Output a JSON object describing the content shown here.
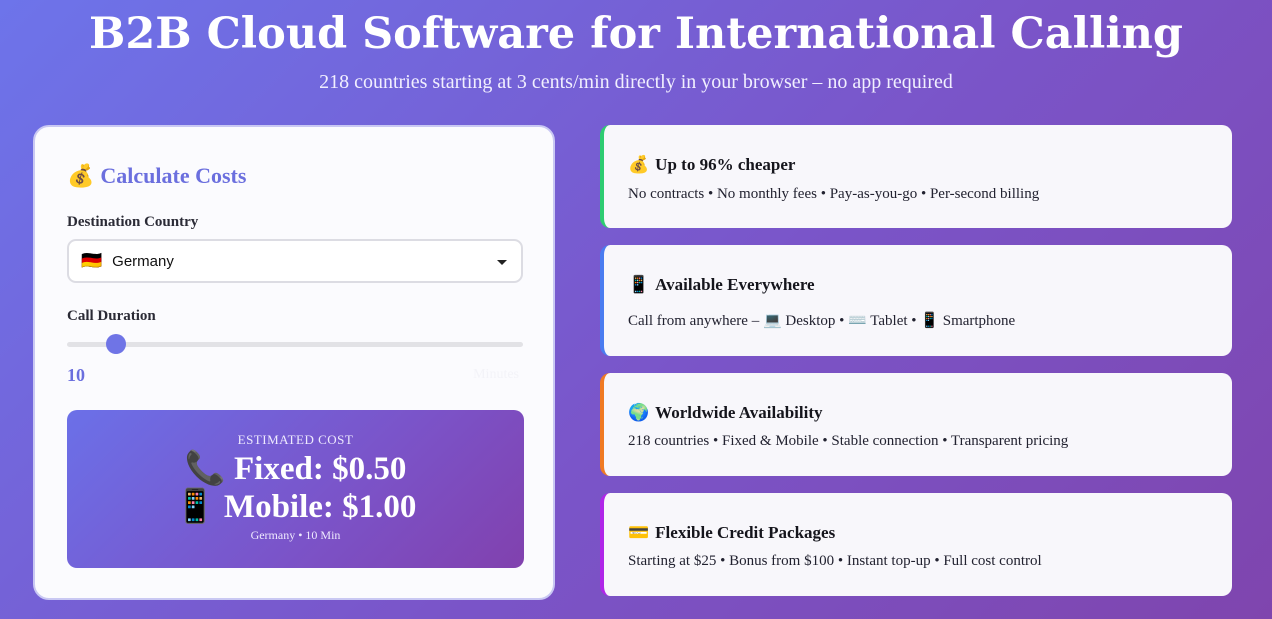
{
  "hero": {
    "title": "B2B Cloud Software for International Calling",
    "subtitle": "218 countries starting at 3 cents/min directly in your browser – no app required"
  },
  "calculator": {
    "title_icon": "💰",
    "title": "Calculate Costs",
    "destination_label": "Destination Country",
    "selected_country_flag": "🇩🇪",
    "selected_country": "Germany",
    "duration_label": "Call Duration",
    "duration_value": "10",
    "duration_unit": "Minutes",
    "duration_fraction": 0.09,
    "result": {
      "label": "ESTIMATED COST",
      "fixed": "📞 Fixed: $0.50",
      "mobile": "📱 Mobile: $1.00",
      "meta": "Germany • 10 Min"
    }
  },
  "features": [
    {
      "icon": "💰",
      "title": "Up to 96% cheaper",
      "text": "No contracts • No monthly fees • Pay-as-you-go • Per-second billing",
      "accent": "#2ecc71"
    },
    {
      "icon": "📱",
      "title": "Available Everywhere",
      "text": "Call from anywhere – 💻 Desktop • ⌨️ Tablet • 📱 Smartphone",
      "accent": "#4a7cf0"
    },
    {
      "icon": "🌍",
      "title": "Worldwide Availability",
      "text": "218 countries • Fixed & Mobile • Stable connection • Transparent pricing",
      "accent": "#f07a22"
    },
    {
      "icon": "💳",
      "title": "Flexible Credit Packages",
      "text": "Starting at $25 • Bonus from $100 • Instant top-up • Full cost control",
      "accent": "#b026e8"
    }
  ]
}
